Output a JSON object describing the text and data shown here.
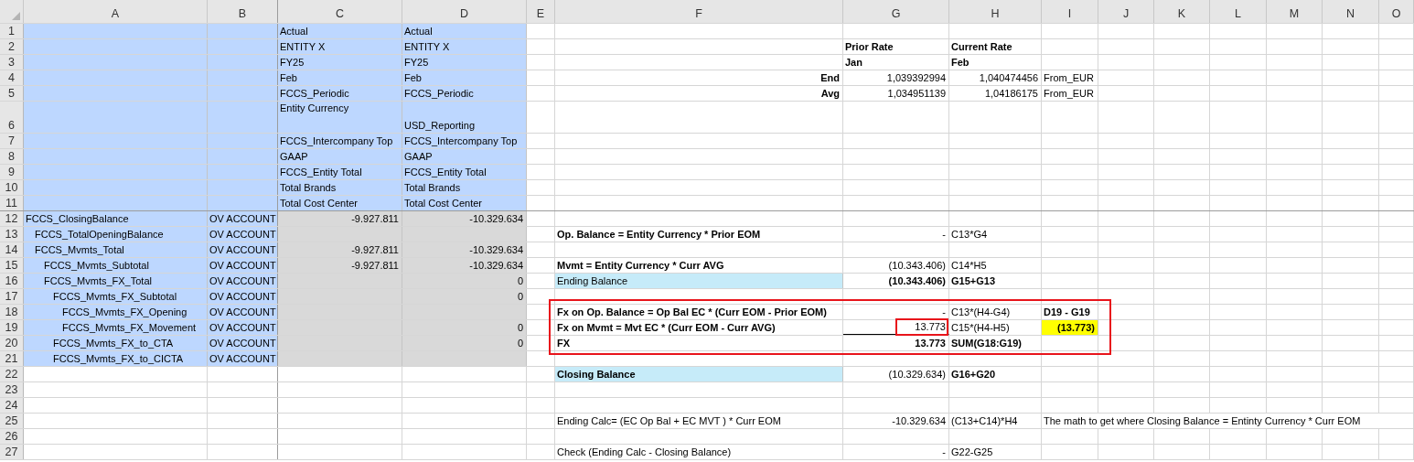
{
  "columns": [
    "A",
    "B",
    "C",
    "D",
    "E",
    "F",
    "G",
    "H",
    "I",
    "J",
    "K",
    "L",
    "M",
    "N",
    "O"
  ],
  "rows": [
    {
      "number": "1",
      "kind": "header",
      "cells": {
        "C": {
          "text": "Actual"
        },
        "D": {
          "text": "Actual"
        }
      }
    },
    {
      "number": "2",
      "kind": "header",
      "cells": {
        "C": {
          "text": "ENTITY X"
        },
        "D": {
          "text": "ENTITY X"
        },
        "G": {
          "text": "Prior Rate",
          "bold": true
        },
        "H": {
          "text": "Current Rate",
          "bold": true
        }
      }
    },
    {
      "number": "3",
      "kind": "header",
      "cells": {
        "C": {
          "text": "FY25"
        },
        "D": {
          "text": "FY25"
        },
        "G": {
          "text": "Jan",
          "bold": true
        },
        "H": {
          "text": "Feb",
          "bold": true
        }
      }
    },
    {
      "number": "4",
      "kind": "header",
      "cells": {
        "C": {
          "text": "Feb"
        },
        "D": {
          "text": "Feb"
        },
        "F": {
          "text": "End",
          "kind": "number",
          "bold": true
        },
        "G": {
          "text": "1,039392994",
          "kind": "number"
        },
        "H": {
          "text": "1,040474456",
          "kind": "number"
        },
        "I": {
          "text": "From_EUR"
        }
      }
    },
    {
      "number": "5",
      "kind": "header",
      "cells": {
        "C": {
          "text": "FCCS_Periodic"
        },
        "D": {
          "text": "FCCS_Periodic"
        },
        "F": {
          "text": "Avg",
          "kind": "number",
          "bold": true
        },
        "G": {
          "text": "1,034951139",
          "kind": "number"
        },
        "H": {
          "text": "1,04186175",
          "kind": "number"
        },
        "I": {
          "text": "From_EUR"
        }
      }
    },
    {
      "number": "6",
      "kind": "header",
      "cells": {
        "C": {
          "text": "Entity Currency",
          "kind": "wrapped"
        },
        "D": {
          "text": "USD_Reporting"
        }
      }
    },
    {
      "number": "7",
      "kind": "header",
      "cells": {
        "C": {
          "text": "FCCS_Intercompany Top"
        },
        "D": {
          "text": "FCCS_Intercompany Top"
        }
      }
    },
    {
      "number": "8",
      "kind": "header",
      "cells": {
        "C": {
          "text": "GAAP"
        },
        "D": {
          "text": "GAAP"
        }
      }
    },
    {
      "number": "9",
      "kind": "header",
      "cells": {
        "C": {
          "text": "FCCS_Entity Total"
        },
        "D": {
          "text": "FCCS_Entity Total"
        }
      }
    },
    {
      "number": "10",
      "kind": "header",
      "cells": {
        "C": {
          "text": "Total Brands"
        },
        "D": {
          "text": "Total Brands"
        }
      }
    },
    {
      "number": "11",
      "kind": "header",
      "cells": {
        "C": {
          "text": "Total Cost Center"
        },
        "D": {
          "text": "Total Cost Center"
        }
      }
    },
    {
      "number": "12",
      "kind": "account"
    },
    {
      "number": "13",
      "kind": "account",
      "cells": {
        "F": {
          "text": "Op. Balance = Entity Currency * Prior EOM",
          "bold": true
        },
        "G": {
          "text": "-",
          "kind": "number"
        },
        "H": {
          "text": "C13*G4"
        }
      }
    },
    {
      "number": "14",
      "kind": "account"
    },
    {
      "number": "15",
      "kind": "account",
      "cells": {
        "F": {
          "text": "Mvmt = Entity Currency * Curr AVG",
          "bold": true
        },
        "G": {
          "text": "(10.343.406)",
          "kind": "number"
        },
        "H": {
          "text": "C14*H5"
        }
      }
    },
    {
      "number": "16",
      "kind": "account",
      "cells": {
        "F": {
          "text": "Ending Balance",
          "color": "#c6ebf9"
        },
        "G": {
          "text": "(10.343.406)",
          "kind": "number",
          "bold": true
        },
        "H": {
          "text": "G15+G13",
          "bold": true
        }
      }
    },
    {
      "number": "17",
      "kind": "account"
    },
    {
      "number": "18",
      "kind": "account",
      "boxed": true,
      "cells": {
        "F": {
          "text": "Fx on Op. Balance = Op Bal EC * (Curr EOM - Prior EOM)",
          "bold": true
        },
        "G": {
          "text": "-",
          "kind": "number"
        },
        "H": {
          "text": "C13*(H4-G4)"
        },
        "I": {
          "text": "D19 - G19",
          "bold": true
        }
      }
    },
    {
      "number": "19",
      "kind": "account",
      "boxed": true,
      "cells": {
        "F": {
          "text": "Fx on Mvmt = Mvt EC * (Curr EOM - Curr AVG)",
          "bold": true
        },
        "G": {
          "text": "13.773",
          "kind": "number",
          "underline": true,
          "boxed": true
        },
        "H": {
          "text": "C15*(H4-H5)"
        },
        "I": {
          "text": "(13.773)",
          "kind": "number",
          "bold": true,
          "color": "#ffff00"
        }
      }
    },
    {
      "number": "20",
      "kind": "account",
      "boxed": true,
      "cells": {
        "F": {
          "text": "FX",
          "bold": true
        },
        "G": {
          "text": "13.773",
          "kind": "number",
          "bold": true
        },
        "H": {
          "text": "SUM(G18:G19)",
          "bold": true
        }
      }
    },
    {
      "number": "21",
      "kind": "account"
    },
    {
      "number": "22",
      "kind": "plain",
      "cells": {
        "F": {
          "text": "Closing Balance",
          "bold": true,
          "color": "#c6ebf9"
        },
        "G": {
          "text": "(10.329.634)",
          "kind": "number"
        },
        "H": {
          "text": "G16+G20",
          "bold": true
        }
      }
    },
    {
      "number": "23",
      "kind": "plain"
    },
    {
      "number": "24",
      "kind": "plain"
    },
    {
      "number": "25",
      "kind": "plain",
      "cells": {
        "F": {
          "text": "Ending Calc= (EC Op Bal + EC MVT ) * Curr EOM"
        },
        "G": {
          "text": "-10.329.634",
          "kind": "number"
        },
        "H": {
          "text": "(C13+C14)*H4"
        },
        "I": {
          "text": "The math to get where Closing Balance = Entinty Currency * Curr EOM",
          "kind": "overflow"
        }
      }
    },
    {
      "number": "26",
      "kind": "plain"
    },
    {
      "number": "27",
      "kind": "plain",
      "cells": {
        "F": {
          "text": "Check (Ending Calc - Closing Balance)"
        },
        "G": {
          "text": "-",
          "kind": "number"
        },
        "H": {
          "text": "G22-G25"
        }
      }
    }
  ],
  "accounts": [
    {
      "label": "FCCS_ClosingBalance",
      "type": "OV ACCOUNT",
      "cells": {
        "C": {
          "text": "-9.927.811"
        },
        "D": {
          "text": "-10.329.634"
        }
      },
      "children": [
        {
          "label": "FCCS_TotalOpeningBalance",
          "type": "OV ACCOUNT"
        },
        {
          "label": "FCCS_Mvmts_Total",
          "type": "OV ACCOUNT",
          "cells": {
            "C": {
              "text": "-9.927.811"
            },
            "D": {
              "text": "-10.329.634"
            }
          },
          "children": [
            {
              "label": "FCCS_Mvmts_Subtotal",
              "type": "OV ACCOUNT",
              "cells": {
                "C": {
                  "text": "-9.927.811"
                },
                "D": {
                  "text": "-10.329.634"
                }
              }
            },
            {
              "label": "FCCS_Mvmts_FX_Total",
              "type": "OV ACCOUNT",
              "cells": {
                "D": {
                  "text": "0"
                }
              },
              "children": [
                {
                  "label": "FCCS_Mvmts_FX_Subtotal",
                  "type": "OV ACCOUNT",
                  "cells": {
                    "D": {
                      "text": "0"
                    }
                  },
                  "children": [
                    {
                      "label": "FCCS_Mvmts_FX_Opening",
                      "type": "OV ACCOUNT"
                    },
                    {
                      "label": "FCCS_Mvmts_FX_Movement",
                      "type": "OV ACCOUNT",
                      "cells": {
                        "D": {
                          "text": "0"
                        }
                      }
                    }
                  ]
                },
                {
                  "label": "FCCS_Mvmts_FX_to_CTA",
                  "type": "OV ACCOUNT",
                  "cells": {
                    "D": {
                      "text": "0"
                    }
                  }
                },
                {
                  "label": "FCCS_Mvmts_FX_to_CICTA",
                  "type": "OV ACCOUNT"
                }
              ]
            }
          ]
        }
      ]
    }
  ]
}
